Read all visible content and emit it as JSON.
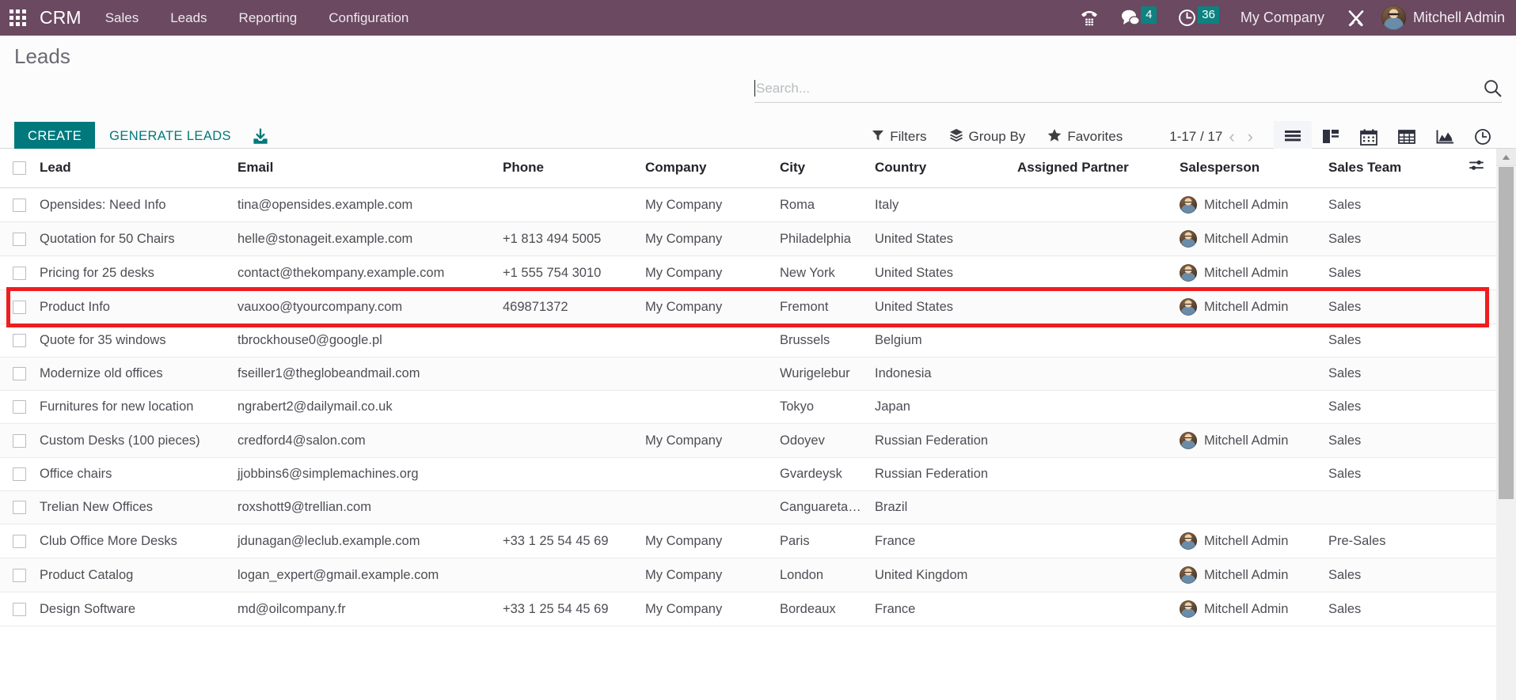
{
  "navbar": {
    "apps_icon": "apps-grid-icon",
    "brand": "CRM",
    "menu": [
      {
        "label": "Sales"
      },
      {
        "label": "Leads"
      },
      {
        "label": "Reporting"
      },
      {
        "label": "Configuration"
      }
    ],
    "system_icons": [
      {
        "name": "voip-phone-icon",
        "badge": null
      },
      {
        "name": "messaging-chat-icon",
        "badge": "4"
      },
      {
        "name": "activities-clock-icon",
        "badge": "36"
      }
    ],
    "company": "My Company",
    "debug_icon": "tools-wrench-icon",
    "user": "Mitchell Admin",
    "colors": {
      "navbar_bg": "#6a4961",
      "badge_bg": "#0e8180"
    }
  },
  "control_panel": {
    "title": "Leads",
    "create_label": "CREATE",
    "generate_leads_label": "GENERATE LEADS",
    "import_icon": "import-download-icon",
    "search": {
      "placeholder": "Search...",
      "value": "",
      "icon": "search-magnifier-icon"
    },
    "filters": [
      {
        "label": "Filters",
        "icon": "filter-funnel-icon"
      },
      {
        "label": "Group By",
        "icon": "group-by-layers-icon"
      },
      {
        "label": "Favorites",
        "icon": "favorites-star-icon"
      }
    ],
    "pager": {
      "range": "1-17 / 17",
      "prev_icon": "chevron-left-icon",
      "next_icon": "chevron-right-icon"
    },
    "views": [
      {
        "name": "list",
        "icon": "list-view-icon",
        "active": true
      },
      {
        "name": "kanban",
        "icon": "kanban-view-icon",
        "active": false
      },
      {
        "name": "calendar",
        "icon": "calendar-view-icon",
        "active": false
      },
      {
        "name": "pivot",
        "icon": "pivot-view-icon",
        "active": false
      },
      {
        "name": "graph",
        "icon": "graph-view-icon",
        "active": false
      },
      {
        "name": "activity",
        "icon": "activity-clock-view-icon",
        "active": false
      }
    ],
    "colors": {
      "create_bg": "#00787c",
      "accent": "#00787c"
    }
  },
  "table": {
    "columns": [
      "Lead",
      "Email",
      "Phone",
      "Company",
      "City",
      "Country",
      "Assigned Partner",
      "Salesperson",
      "Sales Team"
    ],
    "optional_columns_icon": "column-settings-icon",
    "rows": [
      {
        "lead": "Opensides: Need Info",
        "email": "tina@opensides.example.com",
        "phone": "",
        "company": "My Company",
        "city": "Roma",
        "country": "Italy",
        "assigned_partner": "",
        "salesperson": "Mitchell Admin",
        "sales_team": "Sales",
        "highlighted": false
      },
      {
        "lead": "Quotation for 50 Chairs",
        "email": "helle@stonageit.example.com",
        "phone": "+1 813 494 5005",
        "company": "My Company",
        "city": "Philadelphia",
        "country": "United States",
        "assigned_partner": "",
        "salesperson": "Mitchell Admin",
        "sales_team": "Sales",
        "highlighted": false
      },
      {
        "lead": "Pricing for 25 desks",
        "email": "contact@thekompany.example.com",
        "phone": "+1 555 754 3010",
        "company": "My Company",
        "city": "New York",
        "country": "United States",
        "assigned_partner": "",
        "salesperson": "Mitchell Admin",
        "sales_team": "Sales",
        "highlighted": false
      },
      {
        "lead": "Product Info",
        "email": "vauxoo@tyourcompany.com",
        "phone": "469871372",
        "company": "My Company",
        "city": "Fremont",
        "country": "United States",
        "assigned_partner": "",
        "salesperson": "Mitchell Admin",
        "sales_team": "Sales",
        "highlighted": true
      },
      {
        "lead": "Quote for 35 windows",
        "email": "tbrockhouse0@google.pl",
        "phone": "",
        "company": "",
        "city": "Brussels",
        "country": "Belgium",
        "assigned_partner": "",
        "salesperson": "",
        "sales_team": "Sales",
        "highlighted": false
      },
      {
        "lead": "Modernize old offices",
        "email": "fseiller1@theglobeandmail.com",
        "phone": "",
        "company": "",
        "city": "Wurigelebur",
        "country": "Indonesia",
        "assigned_partner": "",
        "salesperson": "",
        "sales_team": "Sales",
        "highlighted": false
      },
      {
        "lead": "Furnitures for new location",
        "email": "ngrabert2@dailymail.co.uk",
        "phone": "",
        "company": "",
        "city": "Tokyo",
        "country": "Japan",
        "assigned_partner": "",
        "salesperson": "",
        "sales_team": "Sales",
        "highlighted": false
      },
      {
        "lead": "Custom Desks (100 pieces)",
        "email": "credford4@salon.com",
        "phone": "",
        "company": "My Company",
        "city": "Odoyev",
        "country": "Russian Federation",
        "assigned_partner": "",
        "salesperson": "Mitchell Admin",
        "sales_team": "Sales",
        "highlighted": false
      },
      {
        "lead": "Office chairs",
        "email": "jjobbins6@simplemachines.org",
        "phone": "",
        "company": "",
        "city": "Gvardeysk",
        "country": "Russian Federation",
        "assigned_partner": "",
        "salesperson": "",
        "sales_team": "Sales",
        "highlighted": false
      },
      {
        "lead": "Trelian New Offices",
        "email": "roxshott9@trellian.com",
        "phone": "",
        "company": "",
        "city": "Canguaretama",
        "country": "Brazil",
        "assigned_partner": "",
        "salesperson": "",
        "sales_team": "",
        "highlighted": false
      },
      {
        "lead": "Club Office More Desks",
        "email": "jdunagan@leclub.example.com",
        "phone": "+33 1 25 54 45 69",
        "company": "My Company",
        "city": "Paris",
        "country": "France",
        "assigned_partner": "",
        "salesperson": "Mitchell Admin",
        "sales_team": "Pre-Sales",
        "highlighted": false
      },
      {
        "lead": "Product Catalog",
        "email": "logan_expert@gmail.example.com",
        "phone": "",
        "company": "My Company",
        "city": "London",
        "country": "United Kingdom",
        "assigned_partner": "",
        "salesperson": "Mitchell Admin",
        "sales_team": "Sales",
        "highlighted": false
      },
      {
        "lead": "Design Software",
        "email": "md@oilcompany.fr",
        "phone": "+33 1 25 54 45 69",
        "company": "My Company",
        "city": "Bordeaux",
        "country": "France",
        "assigned_partner": "",
        "salesperson": "Mitchell Admin",
        "sales_team": "Sales",
        "highlighted": false
      }
    ]
  },
  "annotation": {
    "type": "red-highlight-box",
    "target_row_lead": "Product Info",
    "color": "#ee1d20"
  }
}
